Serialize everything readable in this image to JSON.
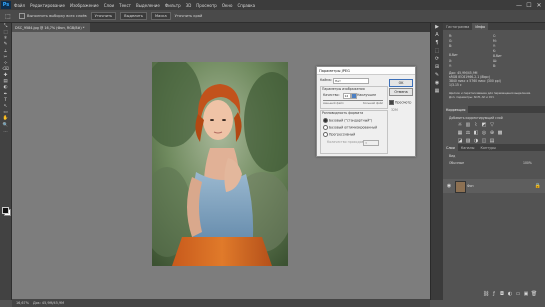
{
  "menubar": {
    "logo": "Ps",
    "items": [
      "Файл",
      "Редактирование",
      "Изображение",
      "Слои",
      "Текст",
      "Выделение",
      "Фильтр",
      "3D",
      "Просмотр",
      "Окно",
      "Справка"
    ],
    "minimize": "—",
    "maximize": "☐",
    "close": "✕"
  },
  "options": {
    "tool_glyph": "⬚",
    "checkbox_label": "Выполнить выборку всех слоёв",
    "button1": "Уточнить",
    "button2": "Выделить",
    "button3": "Маска",
    "refine_label": "Уточнить край"
  },
  "document": {
    "tab_title": "DSC_9584.jpg @ 16,7% (Фон, RGB/8#) *"
  },
  "status": {
    "zoom": "16,67%",
    "doc_info": "Док: 45,9M/45,9M"
  },
  "dialog": {
    "title": "Параметры JPEG",
    "matte_label": "Кайма:",
    "matte_value": "Нет",
    "ok": "OK",
    "cancel": "Отмена",
    "preview_label": "Просмотр",
    "size_label": "32М",
    "image_params": "Параметры изображения",
    "quality_label": "Качество:",
    "quality_value": "12",
    "quality_word": "Наилучшее",
    "small_file": "меньший файл",
    "large_file": "больший файл",
    "format_group": "Разновидность формата",
    "format_baseline": "Базовый (\"стандартный\")",
    "format_optimized": "Базовый оптимизированный",
    "format_progressive": "Прогрессивный",
    "scans_label": "Количество проходов:",
    "scans_value": "3"
  },
  "right_panel": {
    "top_tabs": [
      "Гистограмма",
      "Инфо"
    ],
    "info_r": "R:",
    "info_g": "G:",
    "info_b": "B:",
    "info_c": "C:",
    "info_m": "M:",
    "info_y": "Y:",
    "info_k": "K:",
    "bit_depth_left": "8-бит",
    "bit_depth_right": "8-бит",
    "x_label": "X:",
    "y_label": "Y:",
    "w_label": "Ш:",
    "h_label": "В:",
    "doc_line": "Док: 45,9M/45,9M",
    "profile_line": "sRGB IEC61966-2.1 (8bpc)",
    "size_line": "3840 пикс x 5760 пикс (300 ppi)",
    "time_line": "1/3.15 с",
    "hint_line1": "Щелчок и перетаскивание для перемещения выделения.",
    "hint_line2": "Доп. параметры: Shift, Alt и Ctrl.",
    "adjust_tabs": [
      "Коррекция"
    ],
    "adjust_hint": "Добавить корректирующий слой",
    "layers_tabs": [
      "Слои",
      "Каналы",
      "Контуры"
    ],
    "layer_name": "Фон",
    "kind_label": "Вид",
    "blend_mode": "Обычные",
    "opacity": "100%"
  },
  "toolbar": {
    "tools": [
      "⤡",
      "⬚",
      "⌾",
      "✎",
      "⟂",
      "✂",
      "⊹",
      "⌫",
      "✚",
      "▤",
      "◐",
      "✒",
      "T",
      "↖",
      "▭",
      "✋",
      "🔍",
      "…"
    ]
  },
  "minibar": {
    "icons": [
      "▶",
      "A",
      "¶",
      "⬚",
      "⟳",
      "⊞",
      "✎",
      "◉",
      "▦"
    ]
  }
}
